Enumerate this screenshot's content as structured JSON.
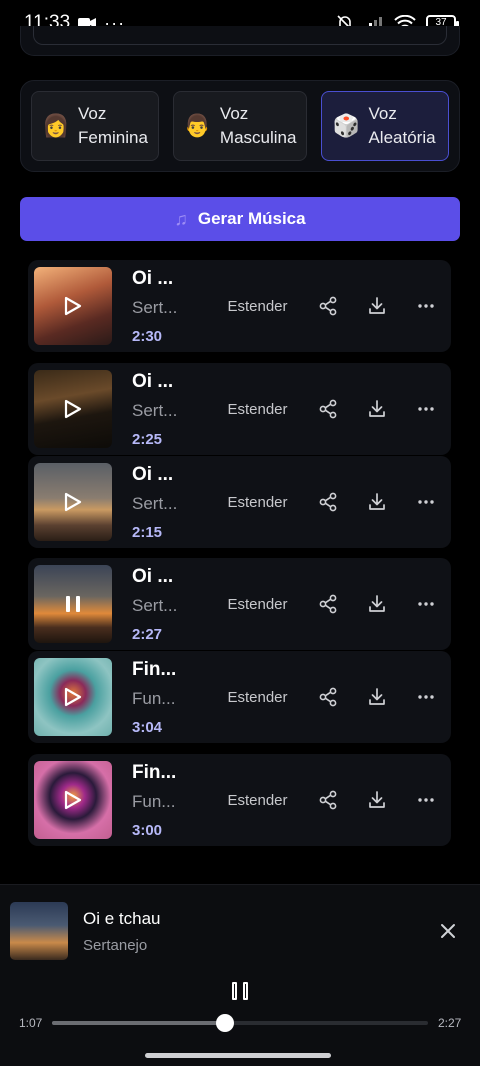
{
  "status_bar": {
    "time": "11:33",
    "battery": "37"
  },
  "voices": [
    {
      "emoji": "👩",
      "line1": "Voz",
      "line2": "Feminina",
      "selected": false
    },
    {
      "emoji": "👨",
      "line1": "Voz",
      "line2": "Masculina",
      "selected": false
    },
    {
      "emoji": "🎲",
      "line1": "Voz",
      "line2": "Aleatória",
      "selected": true
    }
  ],
  "generate": {
    "icon": "music-note-icon",
    "label": "Gerar Música"
  },
  "songs": [
    {
      "title": "Oi ...",
      "genre": "Sert...",
      "duration": "2:30",
      "extend": "Estender",
      "state": "play"
    },
    {
      "title": "Oi ...",
      "genre": "Sert...",
      "duration": "2:25",
      "extend": "Estender",
      "state": "play"
    },
    {
      "title": "Oi ...",
      "genre": "Sert...",
      "duration": "2:15",
      "extend": "Estender",
      "state": "play"
    },
    {
      "title": "Oi ...",
      "genre": "Sert...",
      "duration": "2:27",
      "extend": "Estender",
      "state": "pause"
    },
    {
      "title": "Fin...",
      "genre": "Fun...",
      "duration": "3:04",
      "extend": "Estender",
      "state": "play"
    },
    {
      "title": "Fin...",
      "genre": "Fun...",
      "duration": "3:00",
      "extend": "Estender",
      "state": "play"
    }
  ],
  "player": {
    "title": "Oi e tchau",
    "genre": "Sertanejo",
    "current_time": "1:07",
    "total_time": "2:27",
    "progress": 0.46
  }
}
